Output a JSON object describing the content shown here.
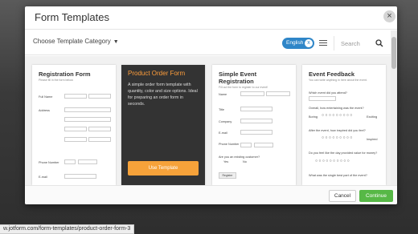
{
  "modal": {
    "title": "Form Templates",
    "close_glyph": "×"
  },
  "toolbar": {
    "category_label": "Choose Template Category",
    "language": "English",
    "language_clear": "x",
    "search_placeholder": "Search"
  },
  "cards": [
    {
      "title": "Registration Form",
      "subtitle": "Please fill in the form below.",
      "fields": [
        "Full Name",
        "Address",
        "Phone Number",
        "E-mail"
      ]
    },
    {
      "title": "Product Order Form",
      "description": "A simple order form template with quantity, color and size options. Ideal for preparing an order form in seconds.",
      "button": "Use Template"
    },
    {
      "title": "Simple Event Registration",
      "subtitle": "Fill out the form to register to our event!",
      "fields": [
        "Name",
        "Title",
        "Company",
        "E-mail",
        "Phone Number",
        "Are you an existing customer?"
      ],
      "options": [
        "Yes",
        "No"
      ],
      "submit": "Register"
    },
    {
      "title": "Event Feedback",
      "subtitle": "You can write anything in here about the event.",
      "questions": [
        "Which event did you attend?",
        "Overall, how entertaining was the event?",
        "After the event, how inspired did you feel?",
        "Do you feel like the day provided value for money?",
        "What was the single best part of the event?"
      ],
      "scale_left": "Boring",
      "scale_right": "Exciting",
      "scale_right2": "Inspired"
    }
  ],
  "footer": {
    "cancel": "Cancel",
    "continue": "Continue"
  },
  "status_url": "w.jotform.com/form-templates/product-order-form-3"
}
